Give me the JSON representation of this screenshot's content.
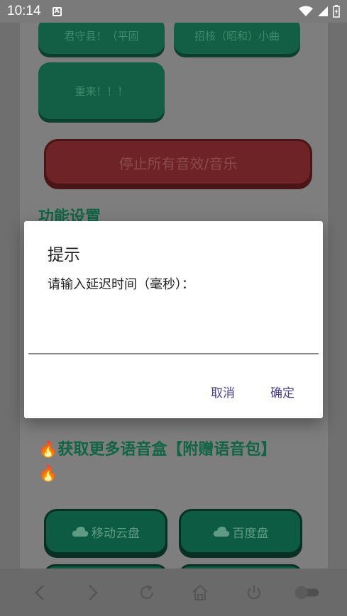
{
  "status_bar": {
    "time": "10:14",
    "notif_letter": "A"
  },
  "page": {
    "top_buttons": [
      "君守县！（平固",
      "招核（昭和）小曲",
      "重来！！！"
    ],
    "stop_button": "停止所有音效/音乐",
    "section_title": "功能设置",
    "promo_title": "获取更多语音盒【附赠语音包】",
    "cloud_buttons": [
      "移动云盘",
      "百度盘"
    ]
  },
  "dialog": {
    "title": "提示",
    "message": "请输入延迟时间（毫秒）：",
    "input_value": "",
    "cancel_label": "取消",
    "confirm_label": "确定"
  },
  "colors": {
    "green_button": "#135f46",
    "red_button": "#6e2326",
    "dialog_accent": "#4a3d8f"
  },
  "nav": [
    "back-icon",
    "forward-icon",
    "refresh-icon",
    "home-icon",
    "power-icon",
    "toggle-switch"
  ]
}
